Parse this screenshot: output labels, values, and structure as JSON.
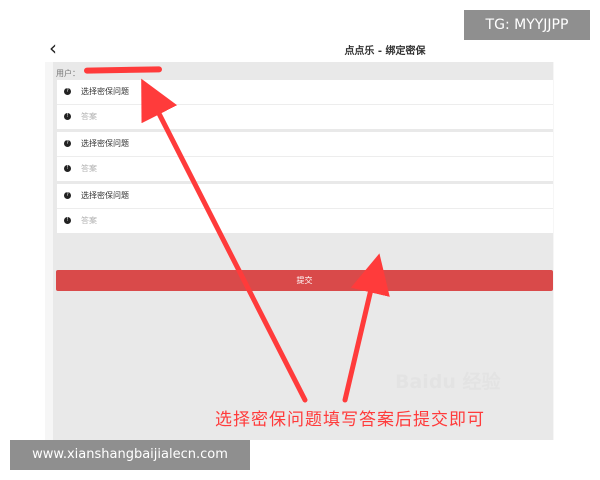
{
  "header": {
    "title": "点点乐 - 绑定密保",
    "back_icon": "chevron-left-icon"
  },
  "user": {
    "label": "用户："
  },
  "security_questions": [
    {
      "question_label": "选择密保问题",
      "answer_placeholder": "答案"
    },
    {
      "question_label": "选择密保问题",
      "answer_placeholder": "答案"
    },
    {
      "question_label": "选择密保问题",
      "answer_placeholder": "答案"
    }
  ],
  "submit": {
    "label": "提交"
  },
  "annotation": {
    "text": "选择密保问题填写答案后提交即可",
    "color": "#ff3b3b"
  },
  "watermarks": {
    "baidu": "Baidu 经验",
    "tg": "TG: MYYJJPP",
    "url": "www.xianshangbaijialecn.com"
  },
  "colors": {
    "accent": "#d94a4a",
    "annotation_red": "#ff3b3b"
  }
}
